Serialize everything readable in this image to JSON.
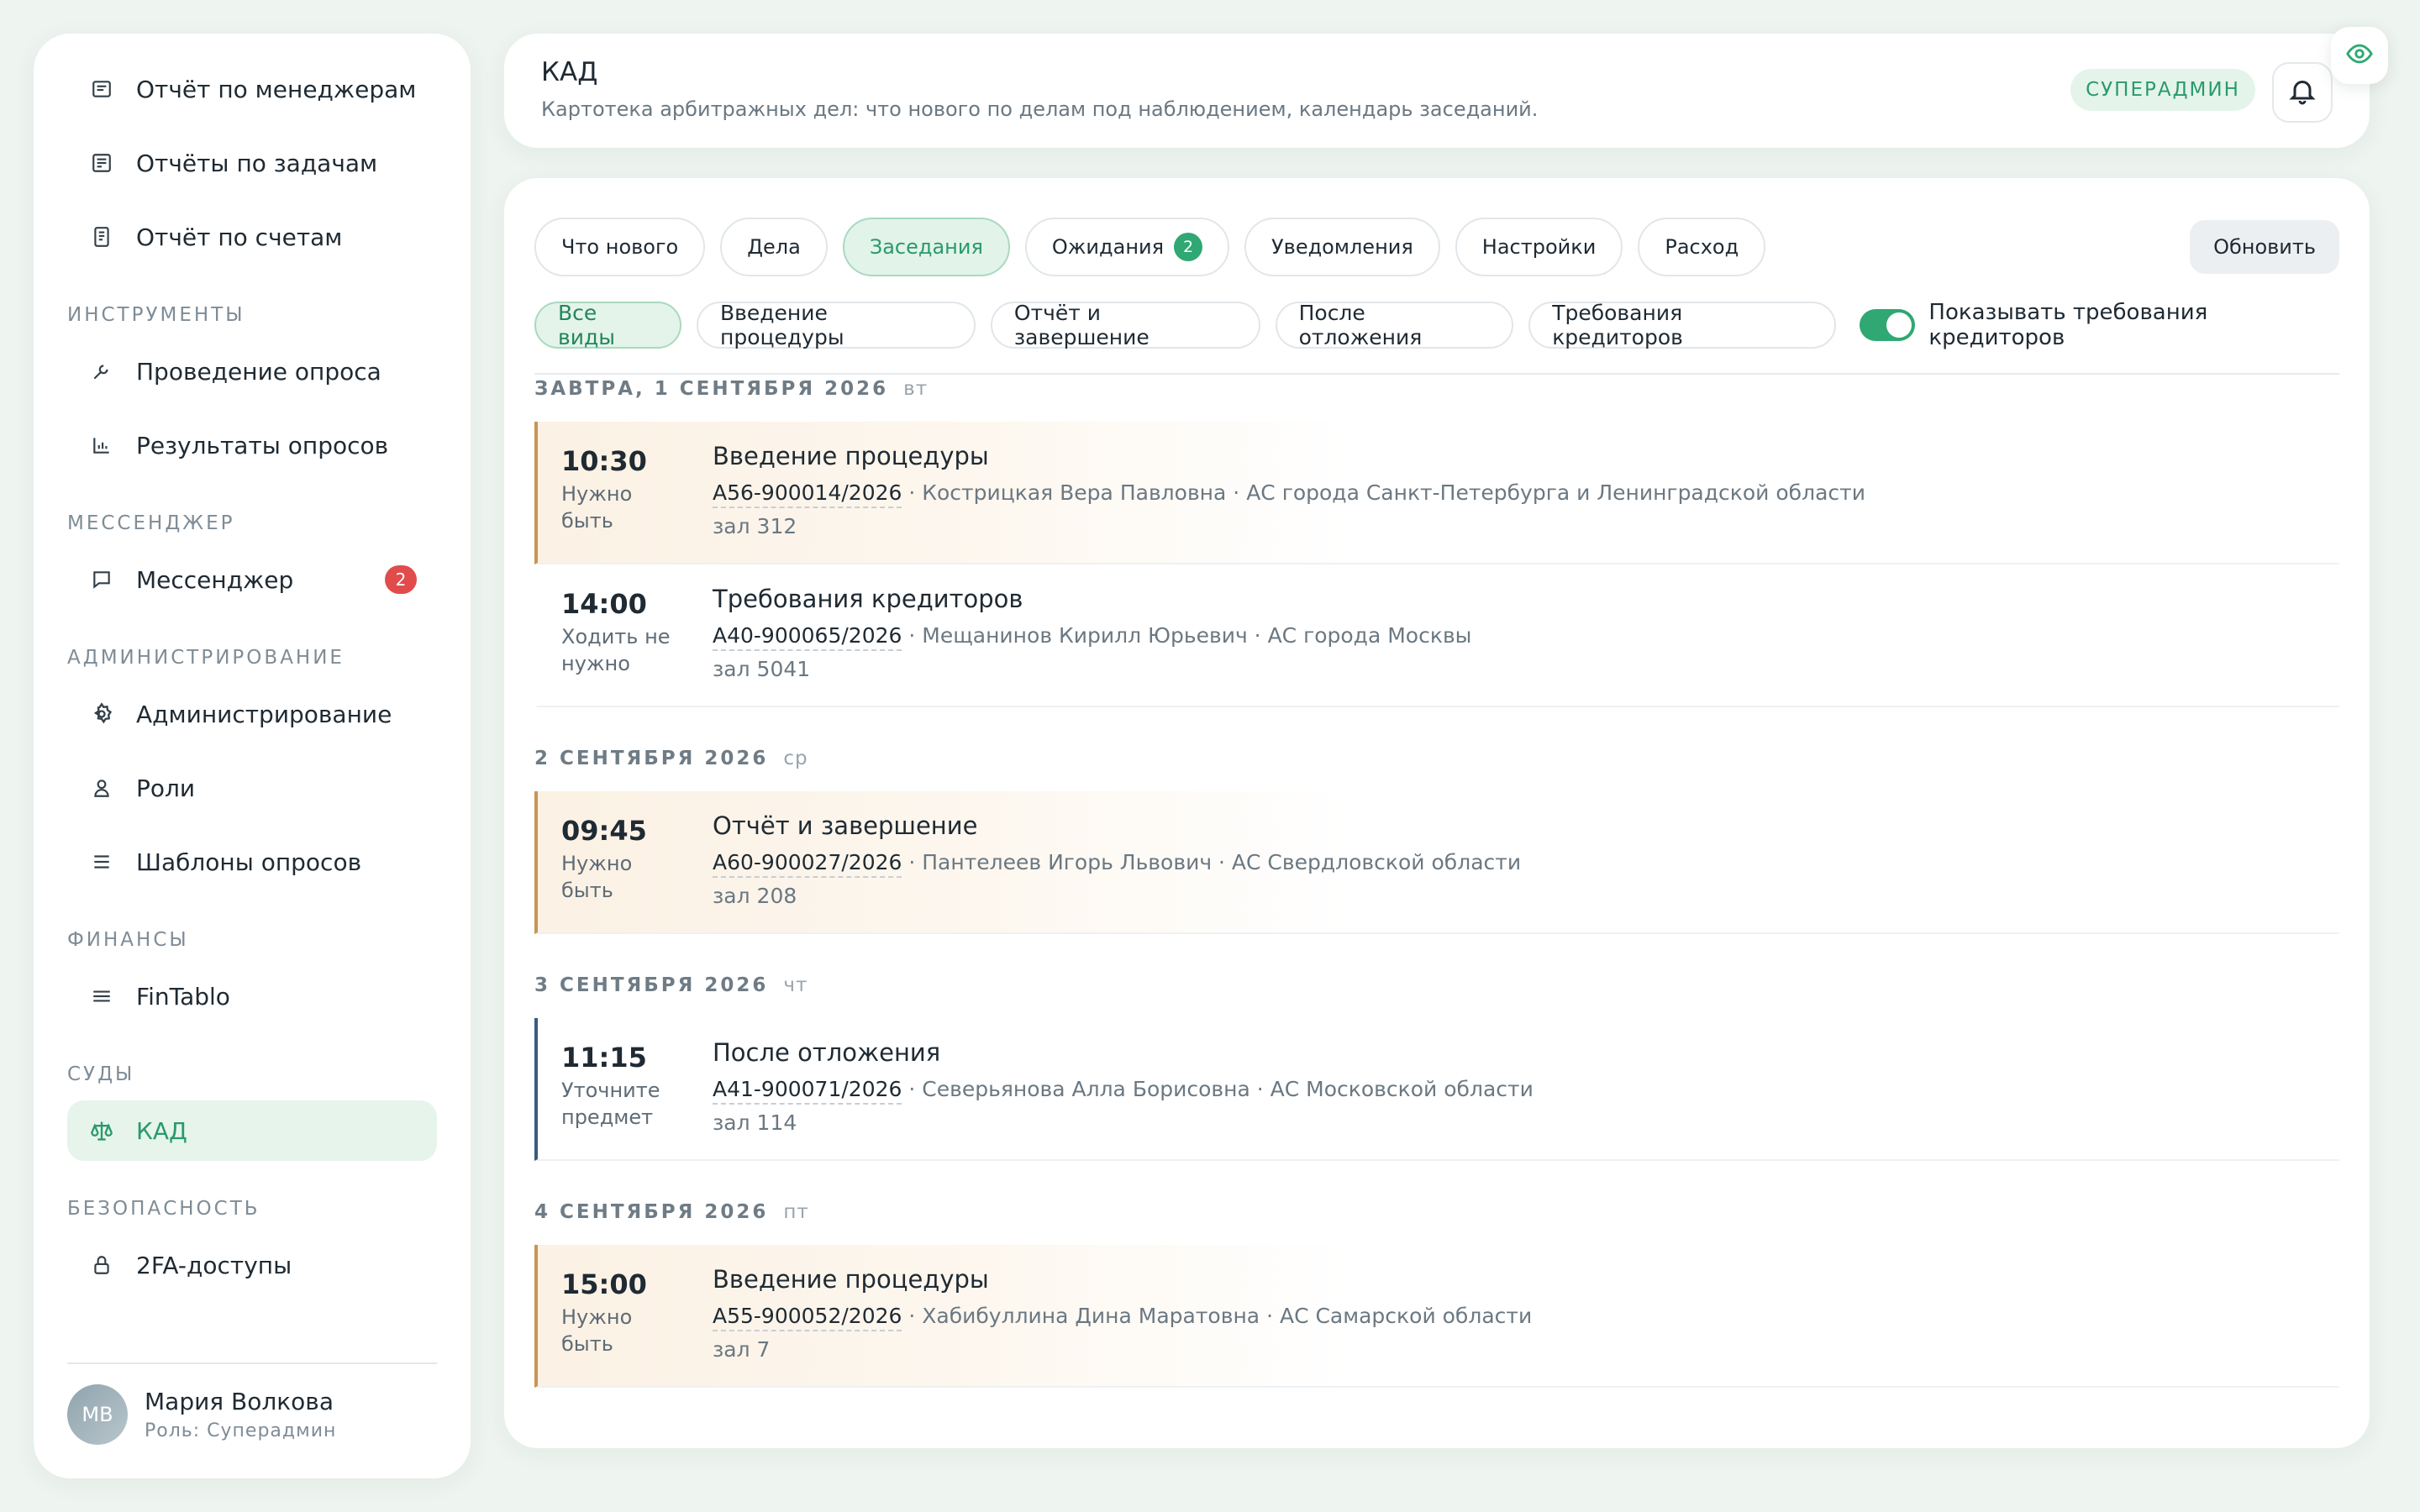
{
  "sidebar": {
    "top_items": [
      {
        "label": "Отчёт по менеджерам",
        "icon": "report-icon"
      },
      {
        "label": "Отчёты по задачам",
        "icon": "tasks-report-icon"
      },
      {
        "label": "Отчёт по счетам",
        "icon": "invoice-icon"
      }
    ],
    "sections": {
      "tools": {
        "label": "ИНСТРУМЕНТЫ",
        "items": [
          {
            "label": "Проведение опроса",
            "icon": "wrench-icon"
          },
          {
            "label": "Результаты опросов",
            "icon": "chart-icon"
          }
        ]
      },
      "messenger": {
        "label": "МЕССЕНДЖЕР",
        "items": [
          {
            "label": "Мессенджер",
            "icon": "chat-icon",
            "badge": "2"
          }
        ]
      },
      "admin": {
        "label": "АДМИНИСТРИРОВАНИЕ",
        "items": [
          {
            "label": "Администрирование",
            "icon": "gear-icon"
          },
          {
            "label": "Роли",
            "icon": "user-icon"
          },
          {
            "label": "Шаблоны опросов",
            "icon": "list-icon"
          }
        ]
      },
      "finance": {
        "label": "ФИНАНСЫ",
        "items": [
          {
            "label": "FinTablo",
            "icon": "menu-icon"
          }
        ]
      },
      "courts": {
        "label": "СУДЫ",
        "items": [
          {
            "label": "КАД",
            "icon": "scales-icon",
            "active": true
          }
        ]
      },
      "security": {
        "label": "БЕЗОПАСНОСТЬ",
        "items": [
          {
            "label": "2FA-доступы",
            "icon": "lock-icon"
          }
        ]
      }
    },
    "user": {
      "initials": "МВ",
      "name": "Мария Волкова",
      "role": "Роль: Суперадмин"
    }
  },
  "header": {
    "title": "КАД",
    "subtitle": "Картотека арбитражных дел: что нового по делам под наблюдением, календарь заседаний.",
    "role_badge": "СУПЕРАДМИН"
  },
  "tabs": [
    {
      "label": "Что нового"
    },
    {
      "label": "Дела"
    },
    {
      "label": "Заседания",
      "active": true
    },
    {
      "label": "Ожидания",
      "badge": "2"
    },
    {
      "label": "Уведомления"
    },
    {
      "label": "Настройки"
    },
    {
      "label": "Расход"
    }
  ],
  "refresh_label": "Обновить",
  "filters": [
    {
      "label": "Все виды",
      "active": true
    },
    {
      "label": "Введение процедуры"
    },
    {
      "label": "Отчёт и завершение"
    },
    {
      "label": "После отложения"
    },
    {
      "label": "Требования кредиторов"
    }
  ],
  "toggle": {
    "label": "Показывать требования кредиторов",
    "on": true
  },
  "days": [
    {
      "head": "ЗАВТРА, 1 СЕНТЯБРЯ 2026",
      "dow": "вт",
      "events": [
        {
          "time": "10:30",
          "note": "Нужно быть",
          "title": "Введение процедуры",
          "case": "А56-900014/2026",
          "details": " · Кострицкая Вера Павловна · АС города Санкт-Петербурга и Ленинградской области",
          "room": "зал 312"
        },
        {
          "time": "14:00",
          "note": "Ходить не нужно",
          "title": "Требования кредиторов",
          "case": "А40-900065/2026",
          "details": " · Мещанинов Кирилл Юрьевич · АС города Москвы",
          "room": "зал 5041"
        }
      ]
    },
    {
      "head": "2 СЕНТЯБРЯ 2026",
      "dow": "ср",
      "events": [
        {
          "time": "09:45",
          "note": "Нужно быть",
          "title": "Отчёт и завершение",
          "case": "А60-900027/2026",
          "details": " · Пантелеев Игорь Львович · АС Свердловской области",
          "room": "зал 208"
        }
      ]
    },
    {
      "head": "3 СЕНТЯБРЯ 2026",
      "dow": "чт",
      "events": [
        {
          "time": "11:15",
          "note": "Уточните предмет",
          "title": "После отложения",
          "case": "А41-900071/2026",
          "details": " · Северьянова Алла Борисовна · АС Московской области",
          "room": "зал 114"
        }
      ]
    },
    {
      "head": "4 СЕНТЯБРЯ 2026",
      "dow": "пт",
      "events": [
        {
          "time": "15:00",
          "note": "Нужно быть",
          "title": "Введение процедуры",
          "case": "А55-900052/2026",
          "details": " · Хабибуллина Дина Маратовна · АС Самарской области",
          "room": "зал 7"
        }
      ]
    }
  ],
  "colors": {
    "accent": "#2fa873",
    "attend": "#c99554",
    "clarify": "#3a5a80",
    "badge_red": "#e14b4b"
  }
}
